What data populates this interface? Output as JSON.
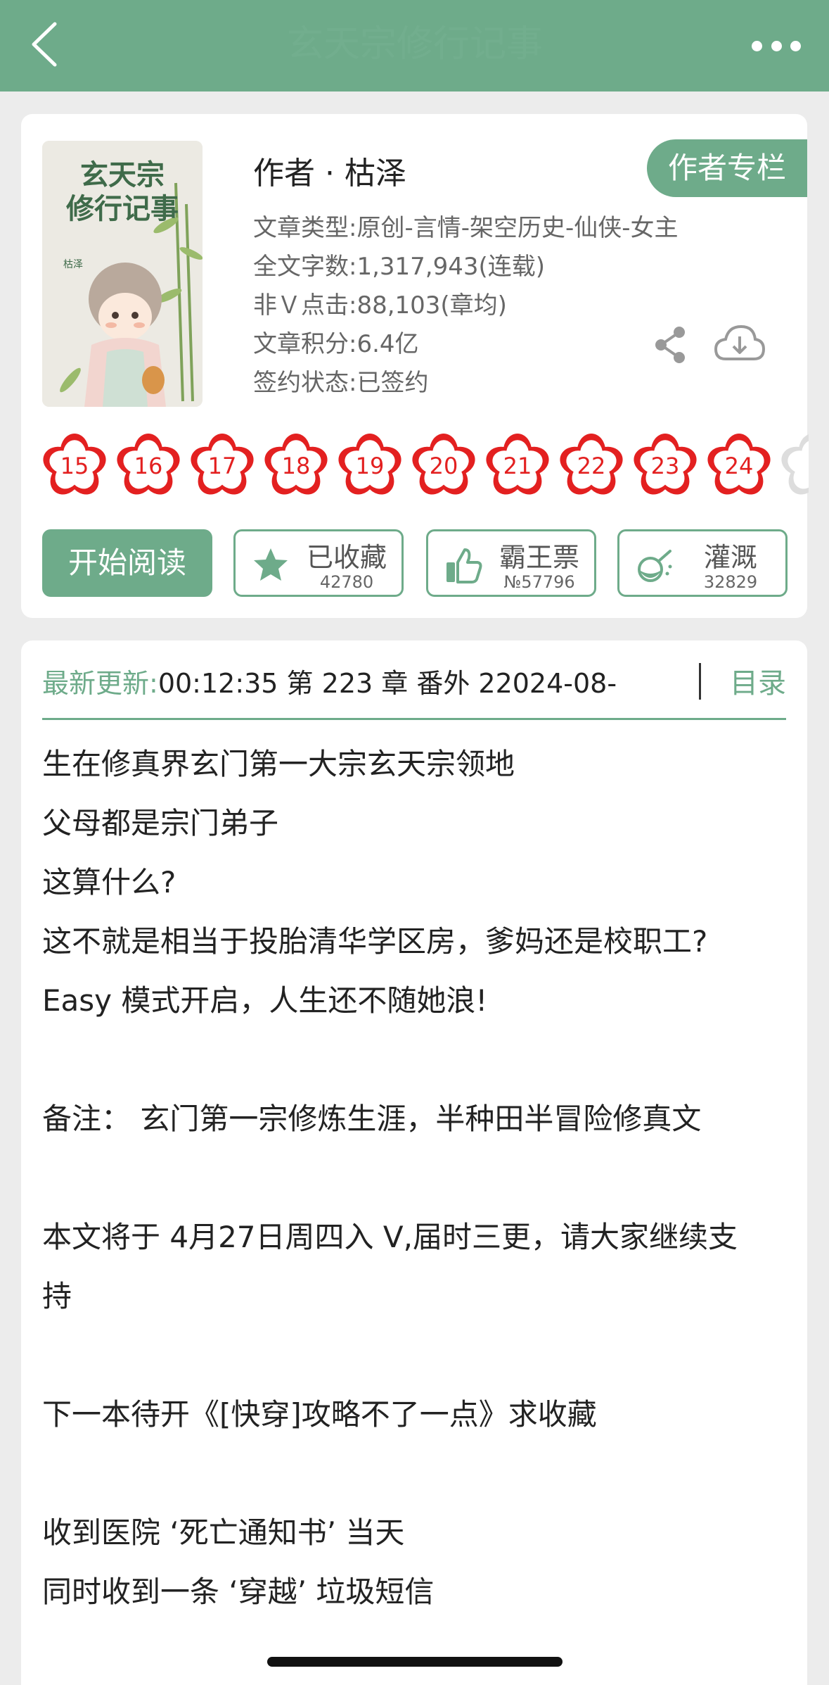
{
  "topbar": {
    "title": "玄天宗修行记事",
    "back_icon": "chevron-left-icon",
    "more_icon": "more-horizontal-icon"
  },
  "book": {
    "cover_title": "玄天宗修行记事",
    "cover_author": "枯泽",
    "author_line": "作者 · 枯泽",
    "author_column_label": "作者专栏",
    "meta": [
      "文章类型:原创-言情-架空历史-仙侠-女主",
      "全文字数:1,317,943(连载)",
      "非Ｖ点击:88,103(章均)",
      "文章积分:6.4亿",
      "签约状态:已签约"
    ],
    "share_icon": "share-icon",
    "download_icon": "cloud-download-icon"
  },
  "flowers": [
    "15",
    "16",
    "17",
    "18",
    "19",
    "20",
    "21",
    "22",
    "23",
    "24"
  ],
  "actions": {
    "read_label": "开始阅读",
    "favorite": {
      "label": "已收藏",
      "count": "42780",
      "icon": "star-icon"
    },
    "vote": {
      "label": "霸王票",
      "count": "№57796",
      "icon": "thumbs-up-icon"
    },
    "nutrient": {
      "label": "灌溉",
      "count": "32829",
      "icon": "flask-icon"
    }
  },
  "latest": {
    "label": "最新更新:",
    "text": "00:12:35   第 223 章  番外 22024-08-",
    "toc_label": "目录"
  },
  "description": [
    "生在修真界玄门第一大宗玄天宗领地",
    "父母都是宗门弟子",
    "这算什么?",
    "这不就是相当于投胎清华学区房，爹妈还是校职工?",
    "Easy 模式开启，人生还不随她浪!",
    "",
    "备注：  玄门第一宗修炼生涯，半种田半冒险修真文",
    "",
    "本文将于 4月27日周四入 V,届时三更，请大家继续支",
    "持",
    "",
    "下一本待开《[快穿]攻略不了一点》求收藏",
    "",
    "收到医院 ‘死亡通知书’ 当天",
    "同时收到一条 ‘穿越’ 垃圾短信"
  ],
  "colors": {
    "accent": "#6eab8a",
    "flower_red": "#e32020"
  }
}
